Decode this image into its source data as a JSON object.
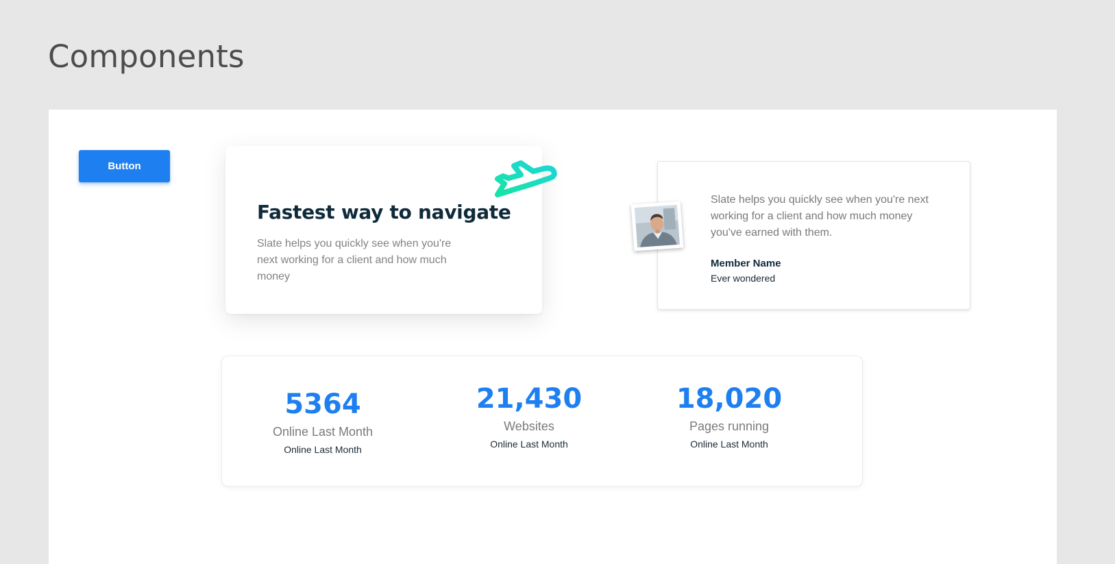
{
  "page": {
    "title": "Components"
  },
  "button": {
    "label": "Button"
  },
  "feature_card": {
    "icon": "airplane-icon",
    "title": "Fastest way to navigate",
    "text": "Slate helps you quickly see when you're next working for a client and how much money"
  },
  "testimonial": {
    "quote": "Slate helps you quickly see when you're next working for a client and how much money you've earned with them.",
    "member_name": "Member Name",
    "member_subtitle": "Ever wondered"
  },
  "stats": [
    {
      "value": "5364",
      "label": "Online Last Month",
      "caption": "Online Last Month"
    },
    {
      "value": "21,430",
      "label": "Websites",
      "caption": "Online Last Month"
    },
    {
      "value": "18,020",
      "label": "Pages running",
      "caption": "Online Last Month"
    }
  ],
  "colors": {
    "background": "#e7e7e7",
    "primary": "#1e7ff0",
    "accent": "#19e3b1",
    "heading": "#0f2a3a",
    "muted": "#7a7a7a"
  }
}
